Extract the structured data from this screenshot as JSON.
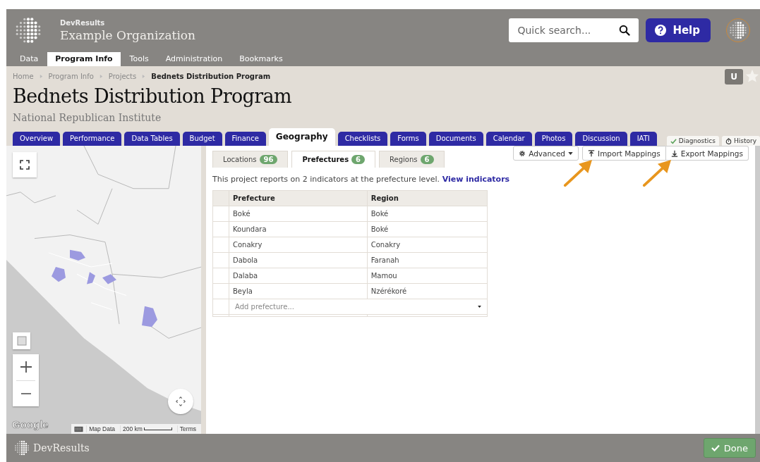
{
  "header": {
    "brand": "DevResults",
    "org": "Example Organization",
    "search_placeholder": "Quick search...",
    "help": "Help"
  },
  "nav": [
    {
      "label": "Data",
      "selected": false
    },
    {
      "label": "Program Info",
      "selected": true
    },
    {
      "label": "Tools",
      "selected": false
    },
    {
      "label": "Administration",
      "selected": false
    },
    {
      "label": "Bookmarks",
      "selected": false
    }
  ],
  "breadcrumb": [
    "Home",
    "Program Info",
    "Projects",
    "Bednets Distribution Program"
  ],
  "user_badge": "U",
  "title": "Bednets Distribution Program",
  "subtitle": "National Republican Institute",
  "tabs": [
    {
      "label": "Overview",
      "selected": false
    },
    {
      "label": "Performance",
      "selected": false
    },
    {
      "label": "Data Tables",
      "selected": false
    },
    {
      "label": "Budget",
      "selected": false
    },
    {
      "label": "Finance",
      "selected": false
    },
    {
      "label": "Geography",
      "selected": true
    },
    {
      "label": "Checklists",
      "selected": false
    },
    {
      "label": "Forms",
      "selected": false
    },
    {
      "label": "Documents",
      "selected": false
    },
    {
      "label": "Calendar",
      "selected": false
    },
    {
      "label": "Photos",
      "selected": false
    },
    {
      "label": "Discussion",
      "selected": false
    },
    {
      "label": "IATI",
      "selected": false
    }
  ],
  "side_tabs": [
    {
      "label": "Diagnostics",
      "kind": "check"
    },
    {
      "label": "History",
      "kind": "clock"
    }
  ],
  "map": {
    "logo": "Google",
    "attribution": [
      "Map Data",
      "200 km",
      "Terms"
    ]
  },
  "subtabs": [
    {
      "label": "Locations",
      "count": "96",
      "selected": false
    },
    {
      "label": "Prefectures",
      "count": "6",
      "selected": true
    },
    {
      "label": "Regions",
      "count": "6",
      "selected": false
    }
  ],
  "toolbar": [
    {
      "label": "Advanced",
      "kind": "dropdown"
    },
    {
      "label": "Import Mappings",
      "kind": "import"
    },
    {
      "label": "Export Mappings",
      "kind": "export"
    }
  ],
  "info": "This project reports on 2 indicators at the prefecture level.",
  "info_link": "View indicators",
  "table": {
    "columns": [
      "Prefecture",
      "Region"
    ],
    "rows": [
      [
        "Boké",
        "Boké"
      ],
      [
        "Koundara",
        "Boké"
      ],
      [
        "Conakry",
        "Conakry"
      ],
      [
        "Dabola",
        "Faranah"
      ],
      [
        "Dalaba",
        "Mamou"
      ],
      [
        "Beyla",
        "Nzérékoré"
      ]
    ],
    "add_placeholder": "Add prefecture..."
  },
  "footer": {
    "brand": "DevResults",
    "done": "Done"
  }
}
